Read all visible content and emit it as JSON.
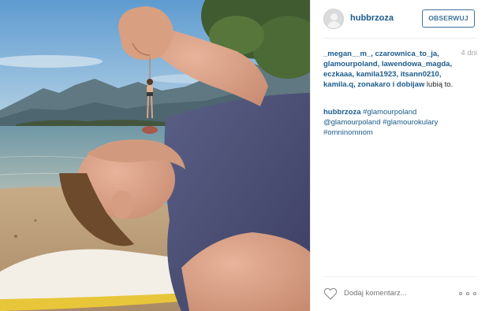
{
  "post": {
    "username": "hubbrzoza",
    "follow_label": "OBSERWUJ",
    "time_ago": "4 dni",
    "likes": {
      "names": "_megan__m_, czarownica_to_ja, glamourpoland, lawendowa_magda, eczkaaa, kamila1923, itsann0210, kamila.q, zonakaro i dobijaw",
      "suffix": " lubią to."
    },
    "caption": {
      "author": "hubbrzoza",
      "text": " #glamourpoland @glamourpoland #glamourokulary #omninomnom"
    },
    "comment_placeholder": "Dodaj komentarz..."
  },
  "icons": {
    "avatar": "default-avatar-icon",
    "like": "heart-icon",
    "more": "more-options-icon"
  },
  "colors": {
    "link": "#1b5b8c",
    "button": "#3f729b",
    "muted": "#a5a7aa"
  }
}
